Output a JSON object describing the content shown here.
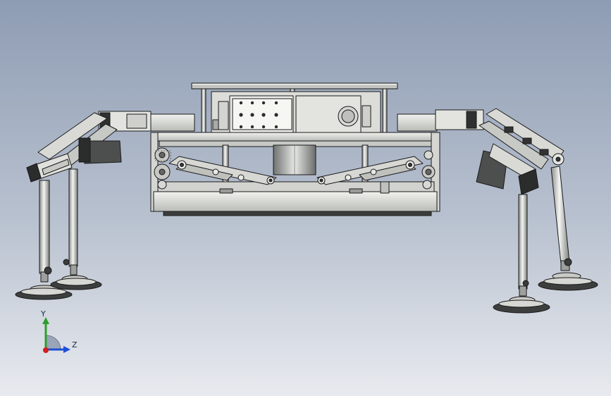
{
  "colors": {
    "bg_top": "#8e9cb3",
    "bg_bottom": "#e5e8ee",
    "steel_light": "#e9eae6",
    "steel_mid": "#c9cbc7",
    "steel_dark": "#8d908d",
    "part_dark": "#4d4f4f",
    "edge": "#1a1a1a",
    "axis_y": "#2e9e2e",
    "axis_z": "#1f4fd6",
    "axis_origin": "#d01f1f"
  },
  "triad": {
    "y_label": "Y",
    "z_label": "Z"
  }
}
